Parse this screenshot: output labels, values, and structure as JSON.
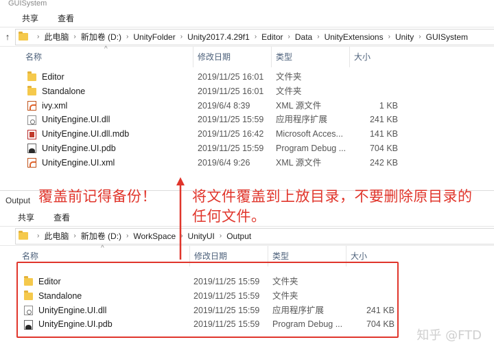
{
  "top_window": {
    "title": "GUISystem",
    "ribbon": [
      "共享",
      "查看"
    ],
    "breadcrumb": [
      "此电脑",
      "新加卷 (D:)",
      "UnityFolder",
      "Unity2017.4.29f1",
      "Editor",
      "Data",
      "UnityExtensions",
      "Unity",
      "GUISystem"
    ],
    "columns": [
      "名称",
      "修改日期",
      "类型",
      "大小"
    ],
    "files": [
      {
        "icon": "folder-icon",
        "name": "Editor",
        "date": "2019/11/25 16:01",
        "type": "文件夹",
        "size": ""
      },
      {
        "icon": "folder-icon",
        "name": "Standalone",
        "date": "2019/11/25 16:01",
        "type": "文件夹",
        "size": ""
      },
      {
        "icon": "xml-file-icon",
        "name": "ivy.xml",
        "date": "2019/6/4 8:39",
        "type": "XML 源文件",
        "size": "1 KB"
      },
      {
        "icon": "dll-file-icon",
        "name": "UnityEngine.UI.dll",
        "date": "2019/11/25 15:59",
        "type": "应用程序扩展",
        "size": "241 KB"
      },
      {
        "icon": "mdb-file-icon",
        "name": "UnityEngine.UI.dll.mdb",
        "date": "2019/11/25 16:42",
        "type": "Microsoft Acces...",
        "size": "141 KB"
      },
      {
        "icon": "pdb-file-icon",
        "name": "UnityEngine.UI.pdb",
        "date": "2019/11/25 15:59",
        "type": "Program Debug ...",
        "size": "704 KB"
      },
      {
        "icon": "xml-file-icon",
        "name": "UnityEngine.UI.xml",
        "date": "2019/6/4 9:26",
        "type": "XML 源文件",
        "size": "242 KB"
      }
    ]
  },
  "bottom_window": {
    "title": "Output",
    "ribbon": [
      "共享",
      "查看"
    ],
    "breadcrumb": [
      "此电脑",
      "新加卷 (D:)",
      "WorkSpace",
      "UnityUI",
      "Output"
    ],
    "columns": [
      "名称",
      "修改日期",
      "类型",
      "大小"
    ],
    "files": [
      {
        "icon": "folder-icon",
        "name": "Editor",
        "date": "2019/11/25 15:59",
        "type": "文件夹",
        "size": ""
      },
      {
        "icon": "folder-icon",
        "name": "Standalone",
        "date": "2019/11/25 15:59",
        "type": "文件夹",
        "size": ""
      },
      {
        "icon": "dll-file-icon",
        "name": "UnityEngine.UI.dll",
        "date": "2019/11/25 15:59",
        "type": "应用程序扩展",
        "size": "241 KB"
      },
      {
        "icon": "pdb-file-icon",
        "name": "UnityEngine.UI.pdb",
        "date": "2019/11/25 15:59",
        "type": "Program Debug ...",
        "size": "704 KB"
      }
    ]
  },
  "annotations": {
    "backup_note": "覆盖前记得备份！",
    "overwrite_note": "将文件覆盖到上放目录，不要删除原目录的任何文件。",
    "color": "#e0352b"
  },
  "watermark": "知乎 @FTD"
}
